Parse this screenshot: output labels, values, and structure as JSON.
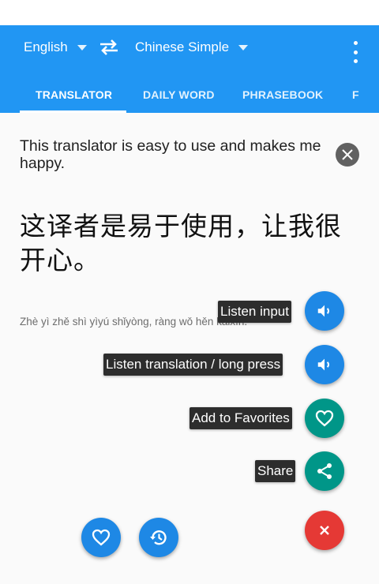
{
  "toolbar": {
    "source_language": "English",
    "target_language": "Chinese Simple"
  },
  "tabs": [
    {
      "label": "TRANSLATOR",
      "active": true
    },
    {
      "label": "DAILY WORD",
      "active": false
    },
    {
      "label": "PHRASEBOOK",
      "active": false
    },
    {
      "label": "F",
      "active": false
    }
  ],
  "translator": {
    "input_text": "This translator is easy to use and makes me happy.",
    "translation": "这译者是易于使用，让我很开心。",
    "pinyin": "Zhè yì zhě shì yìyú shǐyòng, ràng wǒ hěn kāixīn."
  },
  "speed_dial": {
    "listen_input": "Listen input",
    "listen_translation": "Listen translation / long press",
    "add_favorites": "Add to Favorites",
    "share": "Share"
  },
  "icons": {
    "swap": "swap-arrows-icon",
    "menu": "more-vert-icon",
    "clear": "close-icon",
    "speaker": "volume-icon",
    "heart": "heart-icon",
    "share": "share-icon",
    "history": "history-icon",
    "close": "close-icon"
  },
  "colors": {
    "primary": "#2196f3",
    "blue_fab": "#1e88e5",
    "teal_fab": "#009688",
    "red_fab": "#e53935"
  }
}
